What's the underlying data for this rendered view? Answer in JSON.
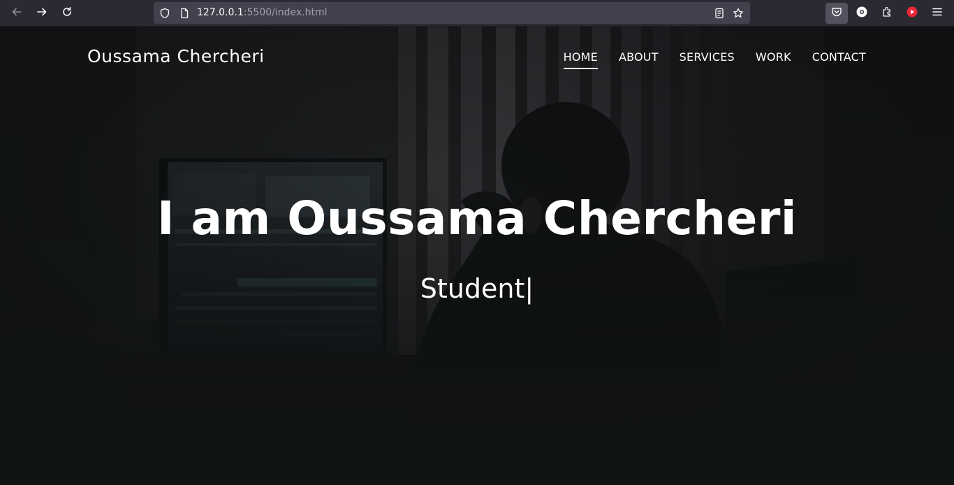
{
  "browser": {
    "url_host": "127.0.0.1",
    "url_rest": ":5500/index.html",
    "icons": [
      "back-arrow-icon",
      "forward-arrow-icon",
      "reload-icon",
      "shield-icon",
      "page-icon",
      "reader-view-icon",
      "bookmark-star-icon",
      "pocket-icon",
      "account-icon",
      "extensions-icon",
      "youtube-extension-icon",
      "menu-icon"
    ]
  },
  "site": {
    "logo": "Oussama Chercheri",
    "nav": [
      {
        "label": "HOME",
        "active": true
      },
      {
        "label": "ABOUT",
        "active": false
      },
      {
        "label": "SERVICES",
        "active": false
      },
      {
        "label": "WORK",
        "active": false
      },
      {
        "label": "CONTACT",
        "active": false
      }
    ]
  },
  "hero": {
    "title": "I am Oussama Chercheri",
    "subtitle": "Student|"
  },
  "colors": {
    "toolbar": "#2b2a33",
    "urlbar": "#42414d",
    "page_bg": "#121516",
    "text": "#ffffff"
  }
}
